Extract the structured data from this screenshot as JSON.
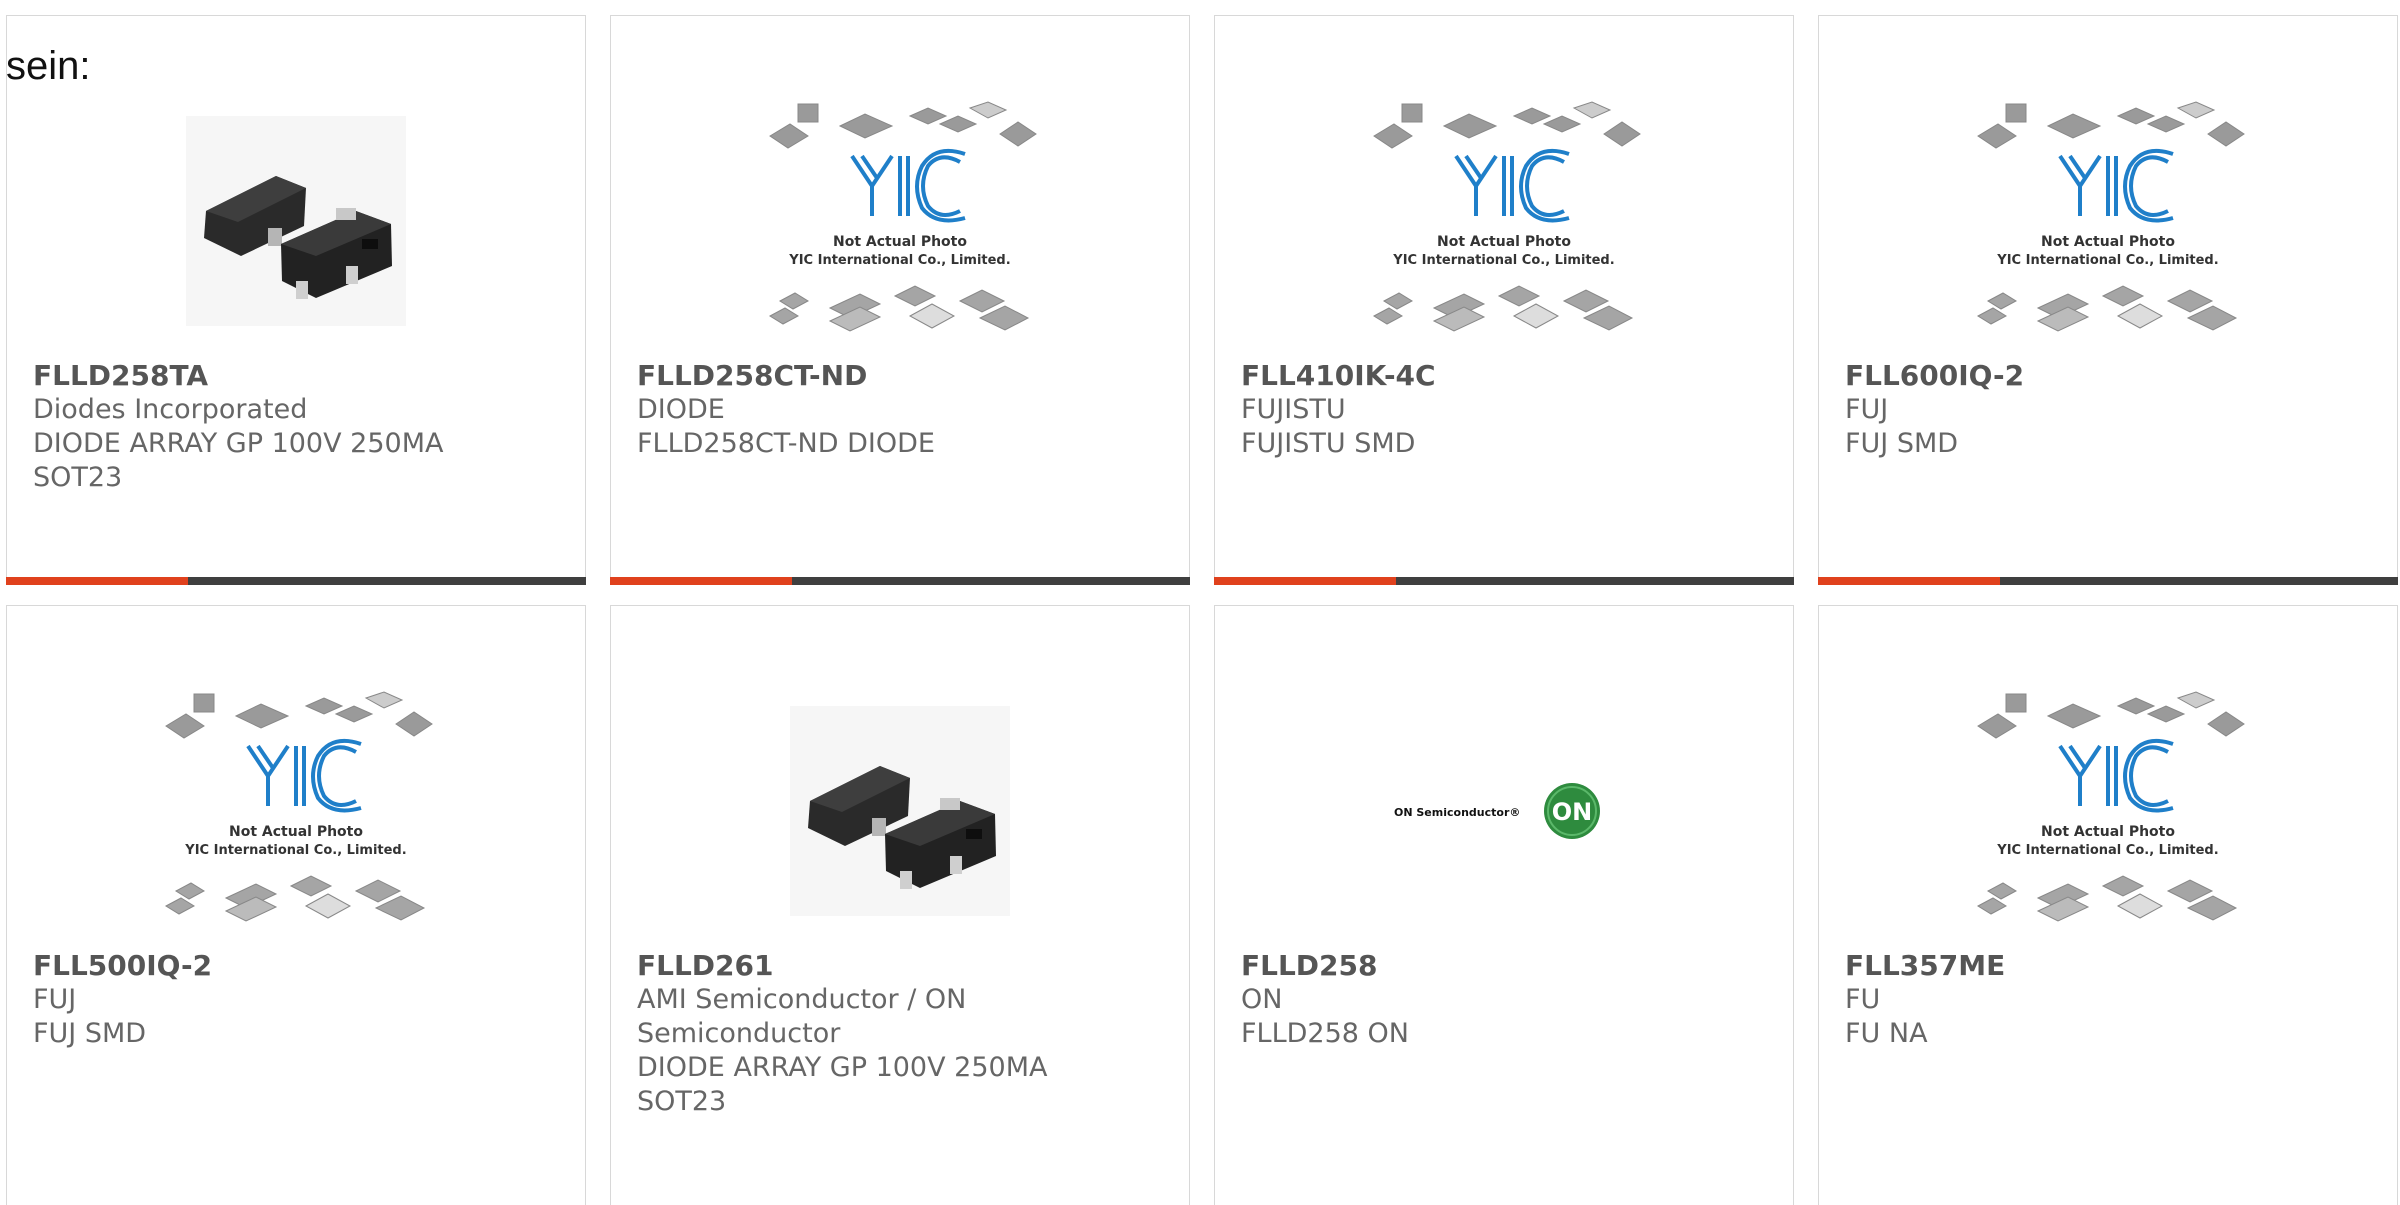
{
  "intro_text": "sein:",
  "colors": {
    "accent": "#e0411d",
    "bar": "#3f3f3f",
    "yic_blue": "#1f7fc9",
    "on_green": "#2e8b3e"
  },
  "products": [
    {
      "part": "FLLD258TA",
      "maker": "Diodes Incorporated",
      "desc": "DIODE ARRAY GP 100V 250MA\nSOT23",
      "image": "sot23-photo",
      "has_bar": true
    },
    {
      "part": "FLLD258CT-ND",
      "maker": "DIODE",
      "desc": "FLLD258CT-ND DIODE",
      "image": "yic-placeholder",
      "has_bar": true
    },
    {
      "part": "FLL410IK-4C",
      "maker": "FUJISTU",
      "desc": "FUJISTU SMD",
      "image": "yic-placeholder",
      "has_bar": true
    },
    {
      "part": "FLL600IQ-2",
      "maker": "FUJ",
      "desc": "FUJ SMD",
      "image": "yic-placeholder",
      "has_bar": true
    },
    {
      "part": "FLL500IQ-2",
      "maker": "FUJ",
      "desc": "FUJ SMD",
      "image": "yic-placeholder",
      "has_bar": false
    },
    {
      "part": "FLLD261",
      "maker": "AMI Semiconductor / ON\nSemiconductor",
      "desc": "DIODE ARRAY GP 100V 250MA\nSOT23",
      "image": "sot23-photo",
      "has_bar": false
    },
    {
      "part": "FLLD258",
      "maker": "ON",
      "desc": "FLLD258 ON",
      "image": "on-semi-logo",
      "has_bar": false
    },
    {
      "part": "FLL357ME",
      "maker": "FU",
      "desc": "FU NA",
      "image": "yic-placeholder",
      "has_bar": false
    }
  ],
  "yic_caption": {
    "line1": "Not Actual Photo",
    "line2": "YIC International Co., Limited."
  },
  "on_logo": {
    "wordmark": "ON Semiconductor®",
    "badge": "ON"
  }
}
